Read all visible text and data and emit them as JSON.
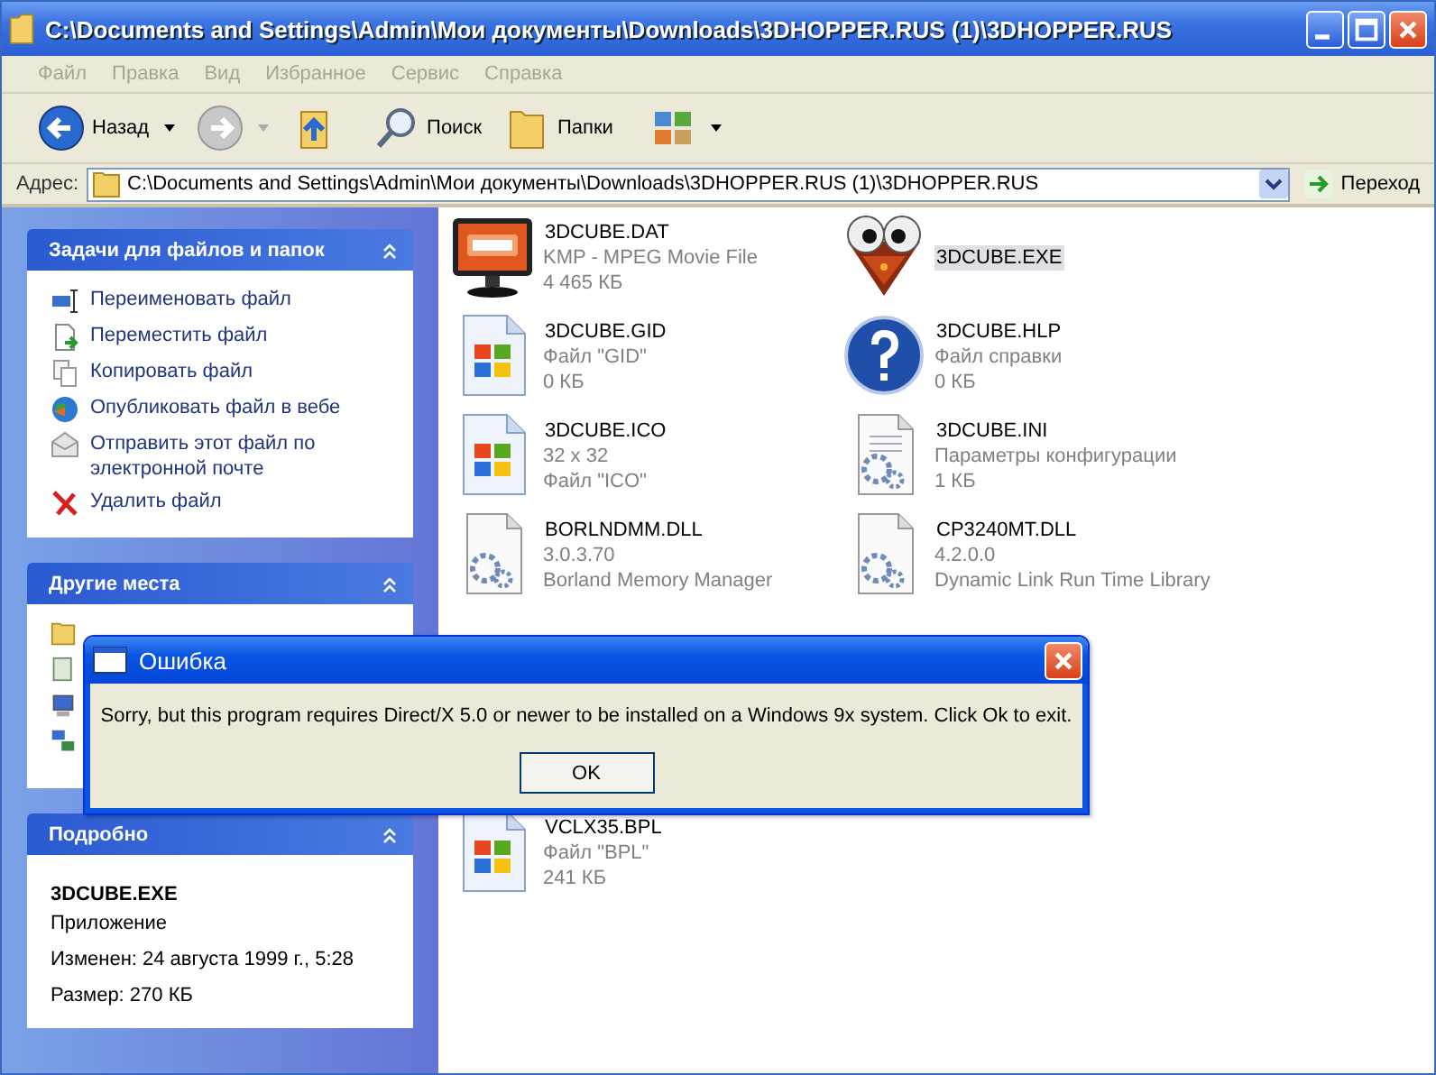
{
  "window": {
    "title": "C:\\Documents and Settings\\Admin\\Мои документы\\Downloads\\3DHOPPER.RUS (1)\\3DHOPPER.RUS"
  },
  "menu": [
    "Файл",
    "Правка",
    "Вид",
    "Избранное",
    "Сервис",
    "Справка"
  ],
  "toolbar": [
    {
      "kind": "back",
      "label": "Назад"
    },
    {
      "kind": "forward"
    },
    {
      "kind": "up"
    },
    {
      "kind": "search",
      "label": "Поиск"
    },
    {
      "kind": "folders",
      "label": "Папки"
    },
    {
      "kind": "views"
    }
  ],
  "address": {
    "label": "Адрес:",
    "value": "C:\\Documents and Settings\\Admin\\Мои документы\\Downloads\\3DHOPPER.RUS (1)\\3DHOPPER.RUS",
    "go": "Переход"
  },
  "tasks": {
    "title": "Задачи для файлов и папок",
    "items": [
      {
        "kind": "rename",
        "label": "Переименовать файл"
      },
      {
        "kind": "move",
        "label": "Переместить файл"
      },
      {
        "kind": "copy",
        "label": "Копировать файл"
      },
      {
        "kind": "web",
        "label": "Опубликовать файл в вебе"
      },
      {
        "kind": "mail",
        "label": "Отправить этот файл по электронной почте"
      },
      {
        "kind": "delete",
        "label": "Удалить файл"
      }
    ]
  },
  "other_places": {
    "title": "Другие места"
  },
  "details": {
    "title": "Подробно",
    "name": "3DCUBE.EXE",
    "type": "Приложение",
    "modified": "Изменен: 24 августа 1999 г., 5:28",
    "size": "Размер: 270 КБ"
  },
  "files": [
    {
      "kind": "dat",
      "name": "3DCUBE.DAT",
      "lines": [
        "KMP - MPEG Movie File",
        "4 465 КБ"
      ],
      "selected": false
    },
    {
      "kind": "exe",
      "name": "3DCUBE.EXE",
      "selected": true
    },
    {
      "kind": "win",
      "name": "3DCUBE.GID",
      "lines": [
        "Файл \"GID\"",
        "0 КБ"
      ],
      "selected": false
    },
    {
      "kind": "help",
      "name": "3DCUBE.HLP",
      "lines": [
        "Файл справки",
        "0 КБ"
      ],
      "selected": false
    },
    {
      "kind": "win",
      "name": "3DCUBE.ICO",
      "lines": [
        "32 x 32",
        "Файл \"ICO\""
      ],
      "selected": false
    },
    {
      "kind": "ini",
      "name": "3DCUBE.INI",
      "lines": [
        "Параметры конфигурации",
        "1 КБ"
      ],
      "selected": false
    },
    {
      "kind": "dll",
      "name": "BORLNDMM.DLL",
      "lines": [
        "3.0.3.70",
        "Borland Memory Manager"
      ],
      "selected": false
    },
    {
      "kind": "dll",
      "name": "CP3240MT.DLL",
      "lines": [
        "4.2.0.0",
        "Dynamic Link Run Time Library"
      ],
      "selected": false
    }
  ],
  "files_below": [
    {
      "kind": "win",
      "name": "VCLX35.BPL",
      "lines": [
        "Файл \"BPL\"",
        "241 КБ"
      ],
      "selected": false
    }
  ],
  "dialog": {
    "title": "Ошибка",
    "message": "Sorry, but this program requires Direct/X 5.0 or newer to be installed on a Windows 9x system. Click Ok to exit.",
    "button": "OK"
  }
}
